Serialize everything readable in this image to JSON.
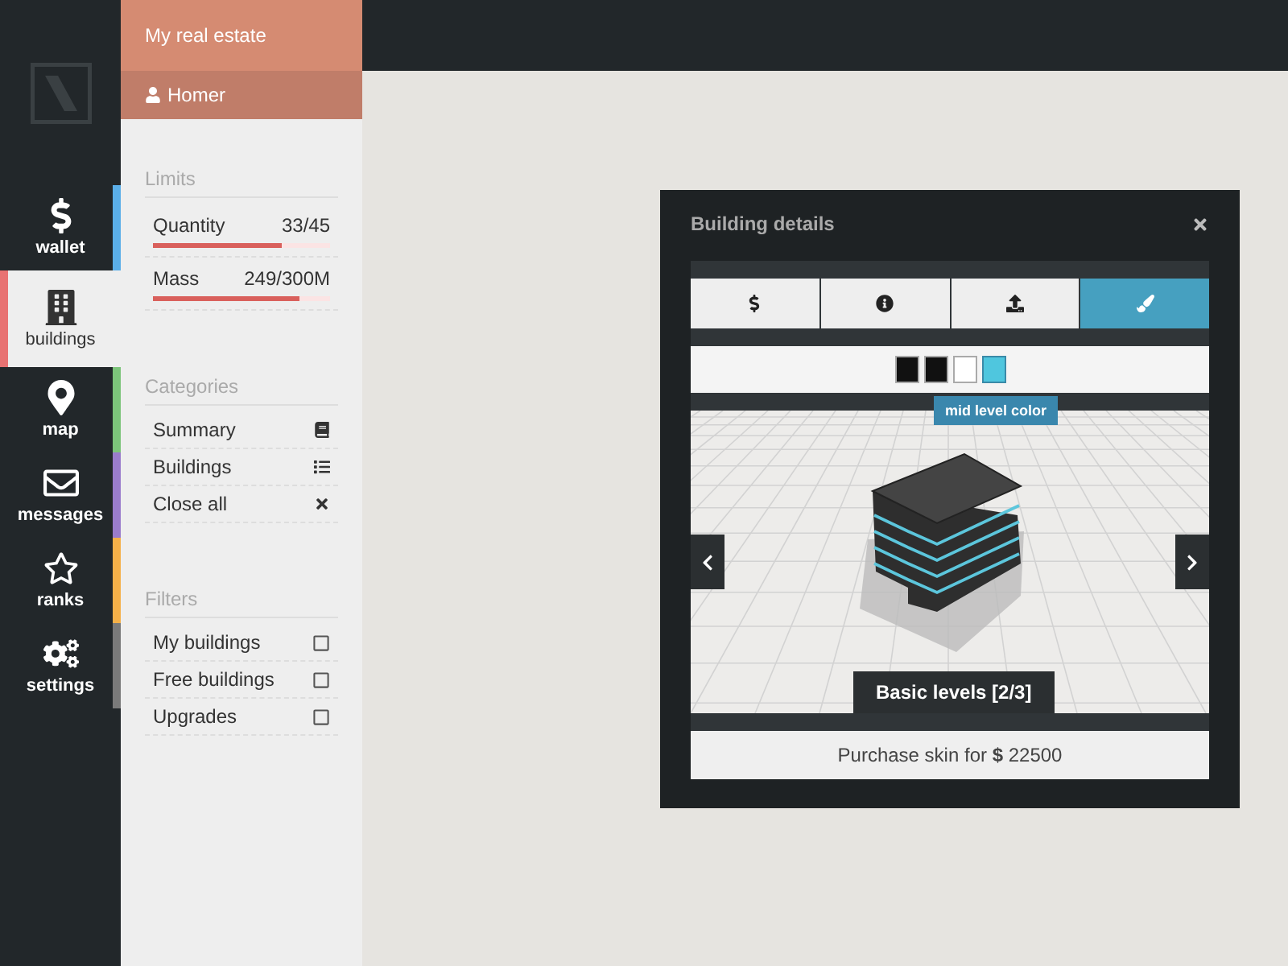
{
  "nav": [
    {
      "label": "wallet",
      "selected": false,
      "color": "#5aaee8"
    },
    {
      "label": "buildings",
      "selected": true,
      "color": "#e87272"
    },
    {
      "label": "map",
      "selected": false,
      "color": "#7cc47a"
    },
    {
      "label": "messages",
      "selected": false,
      "color": "#9a7ccc"
    },
    {
      "label": "ranks",
      "selected": false,
      "color": "#f5b048"
    },
    {
      "label": "settings",
      "selected": false,
      "color": "#7a7a7a"
    }
  ],
  "panel": {
    "title": "My real estate",
    "user": "Homer",
    "limits": {
      "heading": "Limits",
      "items": [
        {
          "label": "Quantity",
          "value": "33/45",
          "level": 0.73
        },
        {
          "label": "Mass",
          "value": "249/300M",
          "level": 0.83
        }
      ]
    },
    "categories": {
      "heading": "Categories",
      "items": [
        "Summary",
        "Buildings",
        "Close all"
      ]
    },
    "filters": {
      "heading": "Filters",
      "items": [
        {
          "label": "My buildings",
          "checked": false
        },
        {
          "label": "Free buildings",
          "checked": false
        },
        {
          "label": "Upgrades",
          "checked": false
        }
      ]
    }
  },
  "dialog": {
    "title": "Building details",
    "tabs": [
      {
        "selected": false
      },
      {
        "selected": false
      },
      {
        "selected": false
      },
      {
        "selected": true
      }
    ],
    "swatches": [
      {
        "color": "#111111",
        "selected": false
      },
      {
        "color": "#111111",
        "selected": false
      },
      {
        "color": "#ffffff",
        "selected": false
      },
      {
        "color": "#4fc6de",
        "selected": true
      }
    ],
    "tooltip": "mid level color",
    "skin_label": "Basic levels [2/3]",
    "purchase": "Purchase skin for **$** 22500"
  }
}
